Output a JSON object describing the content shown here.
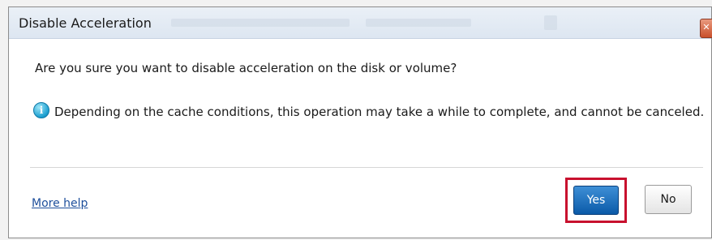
{
  "dialog": {
    "title": "Disable Acceleration",
    "close_glyph": "✕",
    "question": "Are you sure you want to disable acceleration on the disk or volume?",
    "info_icon": "info-icon",
    "info_glyph": "i",
    "info_text": "Depending on the cache conditions, this operation may take a while to complete, and cannot be canceled.",
    "help_link": "More help",
    "buttons": {
      "yes": "Yes",
      "no": "No"
    }
  },
  "colors": {
    "highlight": "#c8102e",
    "primary_button": "#0b5aa8",
    "link": "#1e4f9c"
  }
}
